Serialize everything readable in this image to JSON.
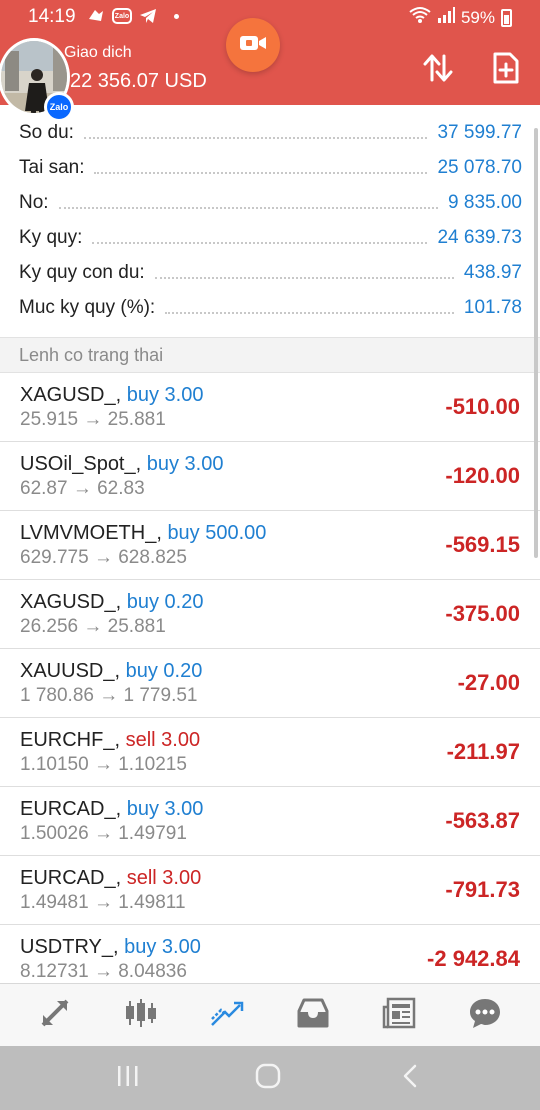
{
  "status_bar": {
    "time": "14:19",
    "zalo_label": "Zalo",
    "battery": "59%"
  },
  "header": {
    "account_title": "Giao dich",
    "balance": "22 356.07 USD",
    "zalo_badge": "Zalo"
  },
  "summary": [
    {
      "label": "So du:",
      "value": "37 599.77"
    },
    {
      "label": "Tai san:",
      "value": "25 078.70"
    },
    {
      "label": "No:",
      "value": "9 835.00"
    },
    {
      "label": "Ky quy:",
      "value": "24 639.73"
    },
    {
      "label": "Ky quy con du:",
      "value": "438.97"
    },
    {
      "label": "Muc ky quy (%):",
      "value": "101.78"
    }
  ],
  "section_title": "Lenh co trang thai",
  "orders": [
    {
      "symbol": "XAGUSD_,",
      "side": "buy 3.00",
      "prices": "25.915 → 25.881",
      "profit": "-510.00"
    },
    {
      "symbol": "USOil_Spot_,",
      "side": "buy 3.00",
      "prices": "62.87 → 62.83",
      "profit": "-120.00"
    },
    {
      "symbol": "LVMVMOETH_,",
      "side": "buy 500.00",
      "prices": "629.775 → 628.825",
      "profit": "-569.15"
    },
    {
      "symbol": "XAGUSD_,",
      "side": "buy 0.20",
      "prices": "26.256 → 25.881",
      "profit": "-375.00"
    },
    {
      "symbol": "XAUUSD_,",
      "side": "buy 0.20",
      "prices": "1 780.86 → 1 779.51",
      "profit": "-27.00"
    },
    {
      "symbol": "EURCHF_,",
      "side": "sell 3.00",
      "prices": "1.10150 → 1.10215",
      "profit": "-211.97"
    },
    {
      "symbol": "EURCAD_,",
      "side": "buy 3.00",
      "prices": "1.50026 → 1.49791",
      "profit": "-563.87"
    },
    {
      "symbol": "EURCAD_,",
      "side": "sell 3.00",
      "prices": "1.49481 → 1.49811",
      "profit": "-791.73"
    },
    {
      "symbol": "USDTRY_,",
      "side": "buy 3.00",
      "prices": "8.12731 → 8.04836",
      "profit": "-2 942.84"
    }
  ],
  "bottom_nav": [
    "quotes-icon",
    "chart-icon",
    "trade-icon",
    "history-icon",
    "news-icon",
    "messages-icon"
  ],
  "colors": {
    "header": "#e0554c",
    "accent_blue": "#1f7fd1",
    "loss_red": "#cc2525",
    "active_nav": "#2a8ae0"
  }
}
